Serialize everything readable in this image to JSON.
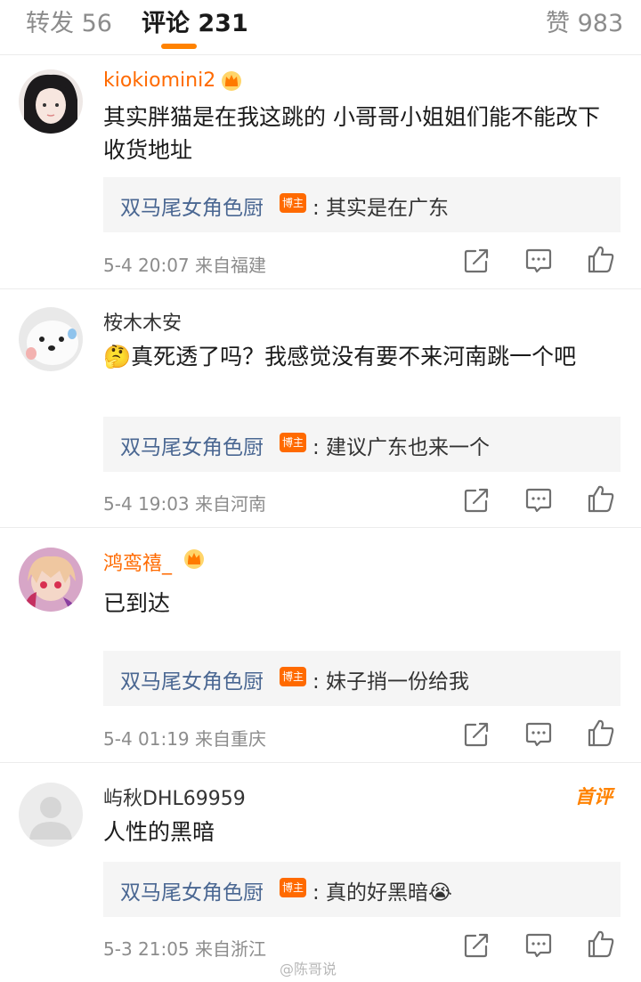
{
  "tabs": [
    {
      "label": "转发 56"
    },
    {
      "label": "评论 231"
    },
    {
      "label": "赞 983"
    }
  ],
  "comments": [
    {
      "username": "kiokiomini2",
      "username_color": "#ff6a00",
      "content": "其实胖猫是在我这跳的 小哥哥小姐姐们能不能改下收货地址",
      "reply_author": "双马尾女角色厨",
      "badge": "博主",
      "reply_text": ": 其实是在广东",
      "meta": "5-4 20:07  来自福建"
    },
    {
      "username": "桉木木安",
      "username_color": "#333333",
      "content_emoji": "🤔",
      "content": "真死透了吗？我感觉没有要不来河南跳一个吧",
      "reply_author": "双马尾女角色厨",
      "badge": "博主",
      "reply_text": ": 建议广东也来一个",
      "meta": "5-4 19:03  来自河南"
    },
    {
      "username": "鸿鸾禧_",
      "username_color": "#ff6a00",
      "content": "已到达",
      "reply_author": "双马尾女角色厨",
      "badge": "博主",
      "reply_text": ": 妹子捎一份给我",
      "meta": "5-4 01:19  来自重庆"
    },
    {
      "username": "屿秋DHL69959",
      "username_color": "#333333",
      "first_badge": "首评",
      "content": "人性的黑暗",
      "reply_author": "双马尾女角色厨",
      "badge": "博主",
      "reply_text": ": 真的好黑暗😭",
      "meta": "5-3 21:05  来自浙江"
    }
  ],
  "watermark": "@陈哥说",
  "icons": {
    "share": "share-icon",
    "comment": "comment-icon",
    "like": "like-icon",
    "crown": "crown-icon"
  },
  "colors": {
    "accent": "#ff8200",
    "reply_author": "#4a6792",
    "badge": "#ff6a00"
  }
}
